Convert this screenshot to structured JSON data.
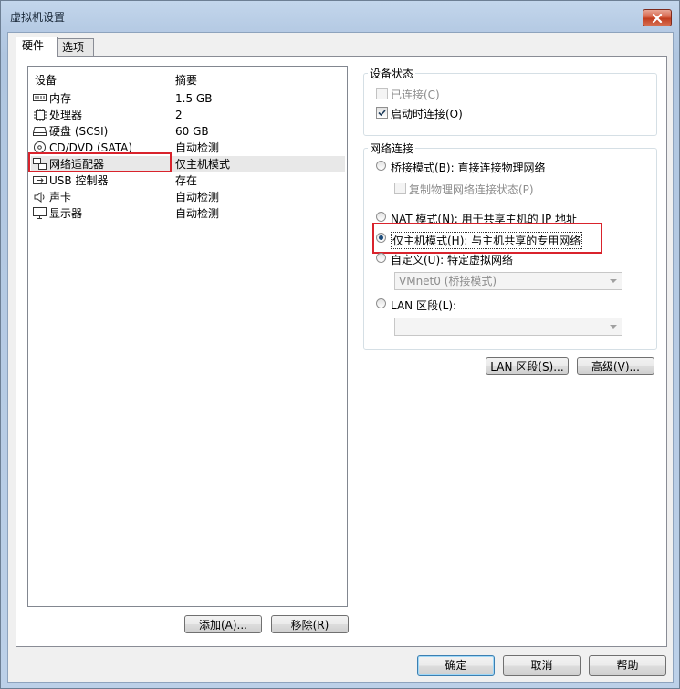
{
  "window": {
    "title": "虚拟机设置",
    "close_icon": "close-icon"
  },
  "tabs": [
    {
      "label": "硬件",
      "active": true
    },
    {
      "label": "选项",
      "active": false
    }
  ],
  "device_list": {
    "columns": [
      "设备",
      "摘要"
    ],
    "rows": [
      {
        "icon": "memory-icon",
        "name": "内存",
        "summary": "1.5 GB"
      },
      {
        "icon": "cpu-icon",
        "name": "处理器",
        "summary": "2"
      },
      {
        "icon": "disk-icon",
        "name": "硬盘 (SCSI)",
        "summary": "60 GB"
      },
      {
        "icon": "cd-icon",
        "name": "CD/DVD (SATA)",
        "summary": "自动检测"
      },
      {
        "icon": "network-icon",
        "name": "网络适配器",
        "summary": "仅主机模式",
        "selected": true
      },
      {
        "icon": "usb-icon",
        "name": "USB 控制器",
        "summary": "存在"
      },
      {
        "icon": "speaker-icon",
        "name": "声卡",
        "summary": "自动检测"
      },
      {
        "icon": "monitor-icon",
        "name": "显示器",
        "summary": "自动检测"
      }
    ]
  },
  "device_buttons": {
    "add": "添加(A)...",
    "remove": "移除(R)"
  },
  "device_status": {
    "title": "设备状态",
    "connected": {
      "label": "已连接(C)",
      "checked": false,
      "enabled": false
    },
    "connect_at_power_on": {
      "label": "启动时连接(O)",
      "checked": true
    }
  },
  "network": {
    "title": "网络连接",
    "bridged": {
      "label": "桥接模式(B): 直接连接物理网络",
      "checked": false
    },
    "replicate": {
      "label": "复制物理网络连接状态(P)",
      "enabled": false
    },
    "nat": {
      "label": "NAT 模式(N): 用于共享主机的 IP 地址",
      "checked": false
    },
    "host_only": {
      "label": "仅主机模式(H): 与主机共享的专用网络",
      "checked": true
    },
    "custom": {
      "label": "自定义(U): 特定虚拟网络",
      "checked": false
    },
    "custom_select": {
      "value": "VMnet0 (桥接模式)"
    },
    "lan": {
      "label": "LAN 区段(L):",
      "checked": false
    },
    "lan_select": {
      "value": ""
    }
  },
  "panel_buttons": {
    "lan_segments": "LAN 区段(S)...",
    "advanced": "高级(V)..."
  },
  "footer": {
    "ok": "确定",
    "cancel": "取消",
    "help": "帮助"
  },
  "highlight_color": "#d9232c"
}
